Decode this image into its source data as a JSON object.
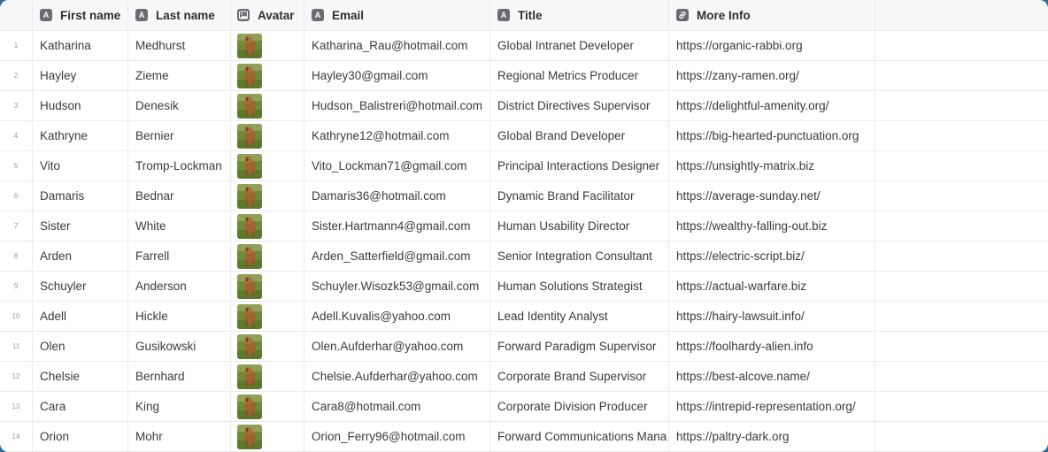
{
  "columns": {
    "first_name": "First name",
    "last_name": "Last name",
    "avatar": "Avatar",
    "email": "Email",
    "title": "Title",
    "more_info": "More Info"
  },
  "icons": {
    "text_column": "text-type-icon",
    "image_column": "image-type-icon",
    "link_column": "link-type-icon",
    "avatar": "dog-photo-thumbnail-icon"
  },
  "rows": [
    {
      "index": "1",
      "first": "Katharina",
      "last": "Medhurst",
      "email": "Katharina_Rau@hotmail.com",
      "title": "Global Intranet Developer",
      "url": "https://organic-rabbi.org"
    },
    {
      "index": "2",
      "first": "Hayley",
      "last": "Zieme",
      "email": "Hayley30@gmail.com",
      "title": "Regional Metrics Producer",
      "url": "https://zany-ramen.org/"
    },
    {
      "index": "3",
      "first": "Hudson",
      "last": "Denesik",
      "email": "Hudson_Balistreri@hotmail.com",
      "title": "District Directives Supervisor",
      "url": "https://delightful-amenity.org/"
    },
    {
      "index": "4",
      "first": "Kathryne",
      "last": "Bernier",
      "email": "Kathryne12@hotmail.com",
      "title": "Global Brand Developer",
      "url": "https://big-hearted-punctuation.org"
    },
    {
      "index": "5",
      "first": "Vito",
      "last": "Tromp-Lockman",
      "email": "Vito_Lockman71@gmail.com",
      "title": "Principal Interactions Designer",
      "url": "https://unsightly-matrix.biz"
    },
    {
      "index": "6",
      "first": "Damaris",
      "last": "Bednar",
      "email": "Damaris36@hotmail.com",
      "title": "Dynamic Brand Facilitator",
      "url": "https://average-sunday.net/"
    },
    {
      "index": "7",
      "first": "Sister",
      "last": "White",
      "email": "Sister.Hartmann4@gmail.com",
      "title": "Human Usability Director",
      "url": "https://wealthy-falling-out.biz"
    },
    {
      "index": "8",
      "first": "Arden",
      "last": "Farrell",
      "email": "Arden_Satterfield@gmail.com",
      "title": "Senior Integration Consultant",
      "url": "https://electric-script.biz/"
    },
    {
      "index": "9",
      "first": "Schuyler",
      "last": "Anderson",
      "email": "Schuyler.Wisozk53@gmail.com",
      "title": "Human Solutions Strategist",
      "url": "https://actual-warfare.biz"
    },
    {
      "index": "10",
      "first": "Adell",
      "last": "Hickle",
      "email": "Adell.Kuvalis@yahoo.com",
      "title": "Lead Identity Analyst",
      "url": "https://hairy-lawsuit.info/"
    },
    {
      "index": "11",
      "first": "Olen",
      "last": "Gusikowski",
      "email": "Olen.Aufderhar@yahoo.com",
      "title": "Forward Paradigm Supervisor",
      "url": "https://foolhardy-alien.info"
    },
    {
      "index": "12",
      "first": "Chelsie",
      "last": "Bernhard",
      "email": "Chelsie.Aufderhar@yahoo.com",
      "title": "Corporate Brand Supervisor",
      "url": "https://best-alcove.name/"
    },
    {
      "index": "13",
      "first": "Cara",
      "last": "King",
      "email": "Cara8@hotmail.com",
      "title": "Corporate Division Producer",
      "url": "https://intrepid-representation.org/"
    },
    {
      "index": "14",
      "first": "Orion",
      "last": "Mohr",
      "email": "Orion_Ferry96@hotmail.com",
      "title": "Forward Communications Mana",
      "url": "https://paltry-dark.org"
    }
  ]
}
